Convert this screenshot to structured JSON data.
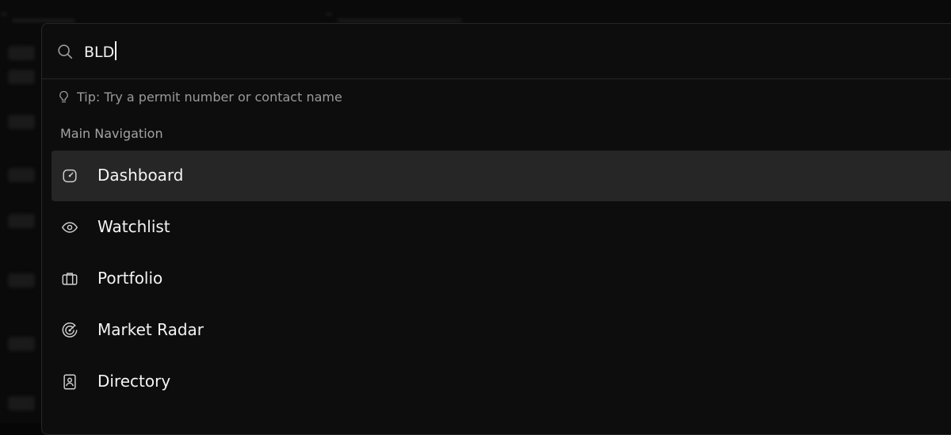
{
  "search": {
    "value": "BLD"
  },
  "tip": {
    "text": "Tip: Try a permit number or contact name"
  },
  "group": {
    "label": "Main Navigation"
  },
  "nav_items": [
    {
      "label": "Dashboard",
      "icon": "dashboard-gauge-icon",
      "active": true
    },
    {
      "label": "Watchlist",
      "icon": "eye-icon",
      "active": false
    },
    {
      "label": "Portfolio",
      "icon": "briefcase-icon",
      "active": false
    },
    {
      "label": "Market Radar",
      "icon": "radar-icon",
      "active": false
    },
    {
      "label": "Directory",
      "icon": "contact-book-icon",
      "active": false
    }
  ],
  "colors": {
    "background": "#0a0a0a",
    "palette": "#0d0d0d",
    "active_row": "#262626",
    "text": "#f4f4f4",
    "muted_text": "#9a9a9a"
  }
}
